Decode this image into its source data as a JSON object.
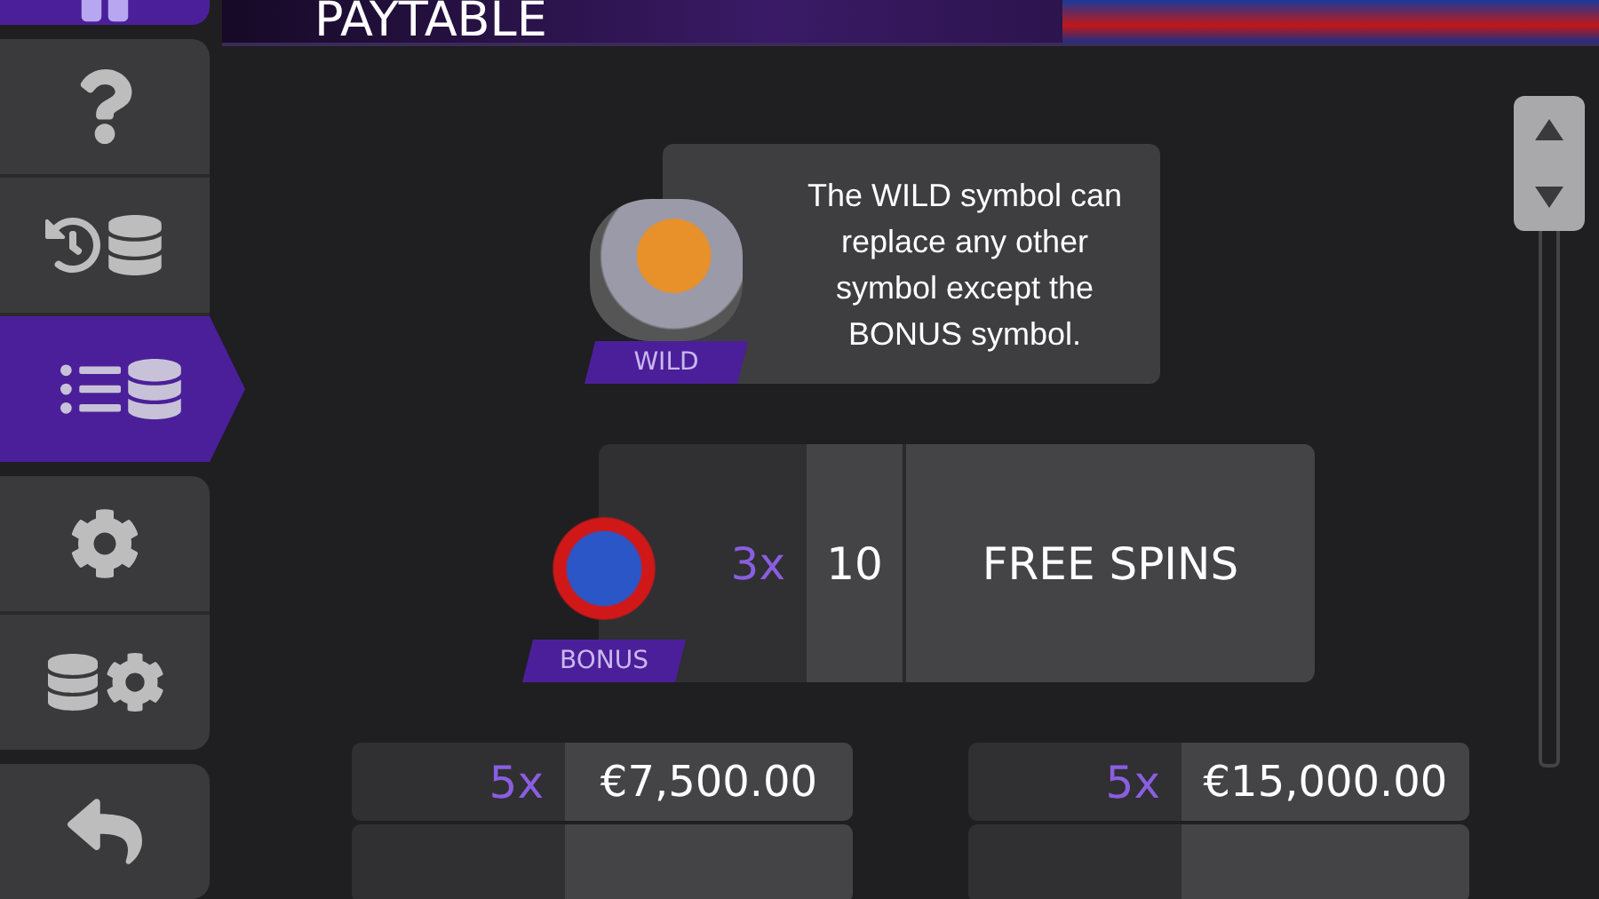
{
  "sidebar": {
    "groups": [
      {
        "items": [
          {
            "kind": "pause",
            "selected": false
          }
        ]
      },
      {
        "items": [
          {
            "kind": "help",
            "selected": false
          },
          {
            "kind": "history",
            "selected": false
          },
          {
            "kind": "paytable",
            "selected": true
          }
        ]
      },
      {
        "items": [
          {
            "kind": "settings",
            "selected": false
          },
          {
            "kind": "bet-settings",
            "selected": false
          }
        ]
      },
      {
        "items": [
          {
            "kind": "back",
            "selected": false
          }
        ]
      }
    ]
  },
  "header": {
    "title": "PAYTABLE"
  },
  "wild": {
    "label": "WILD",
    "description": "The WILD symbol can replace any other symbol except the BONUS symbol."
  },
  "bonus": {
    "label": "BONUS",
    "count": "3x",
    "spins": "10",
    "prize": "FREE SPINS"
  },
  "pays": [
    {
      "count": "5x",
      "amount": "€7,500.00"
    },
    {
      "count": "5x",
      "amount": "€15,000.00"
    }
  ]
}
